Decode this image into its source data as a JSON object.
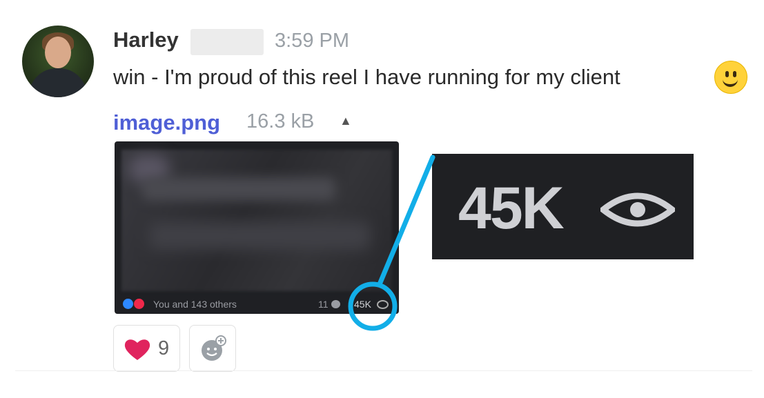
{
  "message": {
    "author": "Harley",
    "time": "3:59 PM",
    "text": "win - I'm proud of this reel I have running for my client",
    "attachment": {
      "name": "image.png",
      "size": "16.3 kB",
      "toggle_glyph": "▲"
    },
    "emoji": "slightly-smiling-face-icon"
  },
  "screenshot": {
    "reactions_text": "You and 143 others",
    "comments_count": "11",
    "views": "45K"
  },
  "zoom_callout": {
    "views": "45K"
  },
  "reactions": [
    {
      "icon": "heart-icon",
      "count": "9"
    }
  ],
  "colors": {
    "link": "#4f5fd6",
    "callout": "#12aee8",
    "heart": "#e0245e",
    "muted": "#9aa0a6"
  }
}
